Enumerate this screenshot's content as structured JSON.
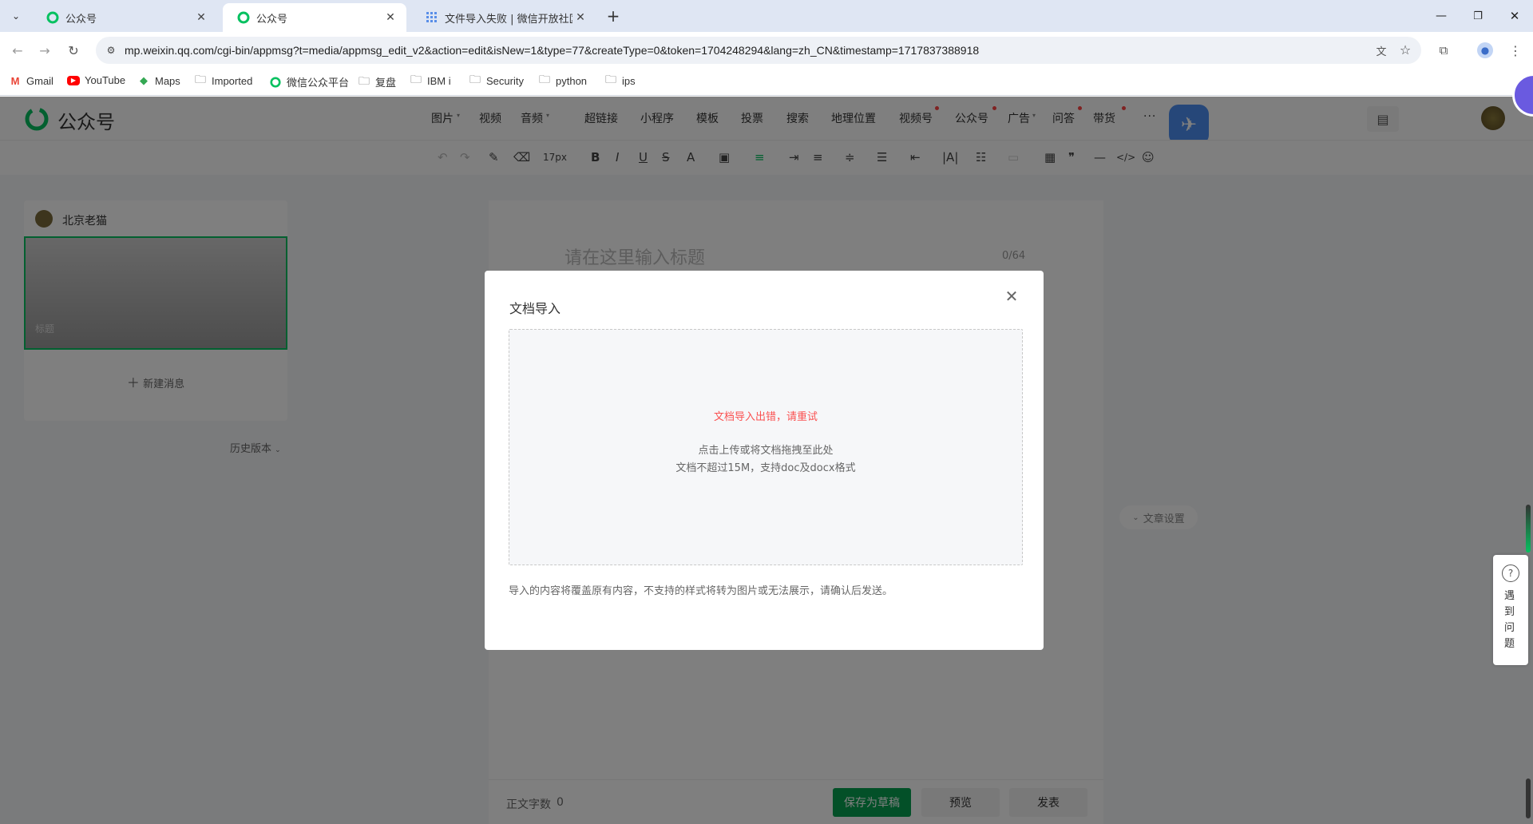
{
  "browser": {
    "tabs": [
      {
        "title": "公众号",
        "active": false
      },
      {
        "title": "公众号",
        "active": true
      },
      {
        "title": "文件导入失败 | 微信开放社区",
        "active": false
      }
    ],
    "url": "mp.weixin.qq.com/cgi-bin/appmsg?t=media/appmsg_edit_v2&action=edit&isNew=1&type=77&createType=0&token=1704248294&lang=zh_CN&timestamp=1717837388918",
    "bookmarks": [
      "Gmail",
      "YouTube",
      "Maps",
      "Imported",
      "微信公众平台",
      "复盘",
      "IBM i",
      "Security",
      "python",
      "ips"
    ]
  },
  "app": {
    "logo_text": "公众号",
    "menu": [
      "图片",
      "视频",
      "音频",
      "超链接",
      "小程序",
      "模板",
      "投票",
      "搜索",
      "地理位置",
      "视频号",
      "公众号",
      "广告",
      "问答",
      "带货",
      "···"
    ],
    "font_size": "17px"
  },
  "left": {
    "account_name": "北京老猫",
    "cover_title_placeholder": "标题",
    "new_message": "新建消息",
    "history": "历史版本"
  },
  "editor": {
    "title_placeholder": "请在这里输入标题",
    "title_count": "0/64",
    "article_settings": "文章设置",
    "word_count_label": "正文字数",
    "word_count": "0",
    "save_draft": "保存为草稿",
    "preview": "预览",
    "publish": "发表"
  },
  "dialog": {
    "title": "文档导入",
    "error": "文档导入出错，请重试",
    "hint1": "点击上传或将文档拖拽至此处",
    "hint2": "文档不超过15M，支持doc及docx格式",
    "notice": "导入的内容将覆盖原有内容，不支持的样式将转为图片或无法展示，请确认后发送。"
  },
  "help": {
    "label": "遇到问题"
  },
  "colors": {
    "brand": "#07c160",
    "error": "#fa5151",
    "save_button": "#07a050"
  }
}
